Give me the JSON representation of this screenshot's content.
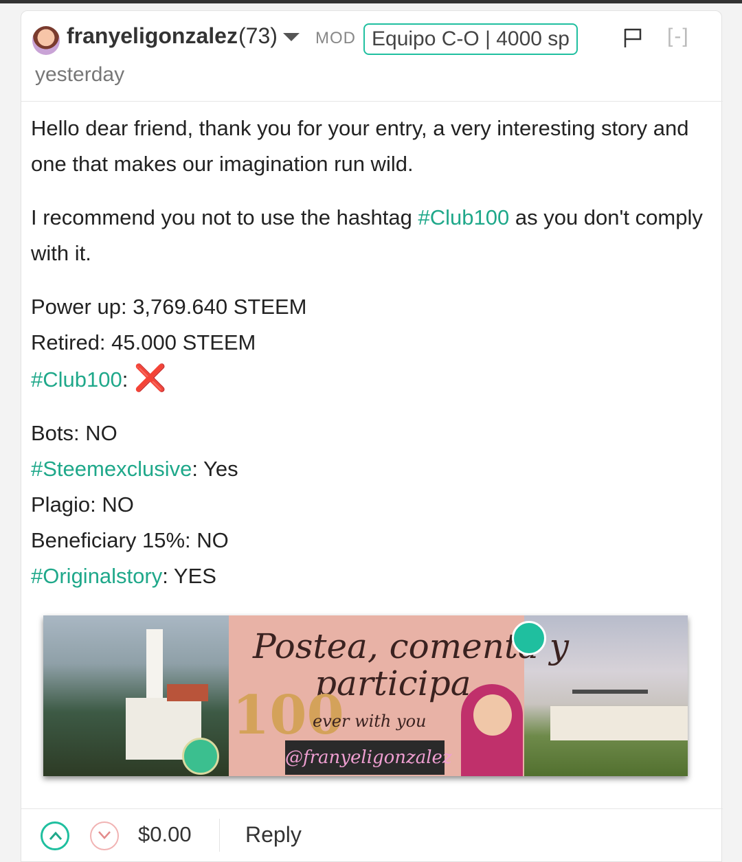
{
  "comment": {
    "author": "franyeligonzalez",
    "reputation": "(73)",
    "role": "MOD",
    "badge": "Equipo C-O | 4000 sp",
    "collapse": "[-]",
    "time": "yesterday",
    "body": {
      "p1": "Hello dear friend, thank you for your entry, a very interesting story and one that makes our imagination run wild.",
      "p2_before": "I recommend you not to use the hashtag ",
      "p2_tag": "#Club100",
      "p2_after": " as you don't comply with it.",
      "power_up": "Power up: 3,769.640 STEEM",
      "retired": "Retired: 45.000 STEEM",
      "club_tag": "#Club100",
      "club_sep": ": ",
      "club_mark": "❌",
      "bots": "Bots: NO",
      "steemexclusive_tag": "#Steemexclusive",
      "steemexclusive_val": ": Yes",
      "plagio": "Plagio: NO",
      "beneficiary": "Beneficiary 15%: NO",
      "originalstory_tag": "#Originalstory",
      "originalstory_val": ": YES"
    },
    "banner": {
      "script_line1": "Postea, comenta y",
      "script_line2": "participa",
      "number": "100",
      "ever": "ever with you",
      "handle": "@franyeligonzalez"
    },
    "footer": {
      "payout": "$0.00",
      "reply": "Reply"
    }
  },
  "colors": {
    "accent": "#1fbf9f",
    "tag": "#1fa88a",
    "downvote": "#f1b3b3"
  }
}
